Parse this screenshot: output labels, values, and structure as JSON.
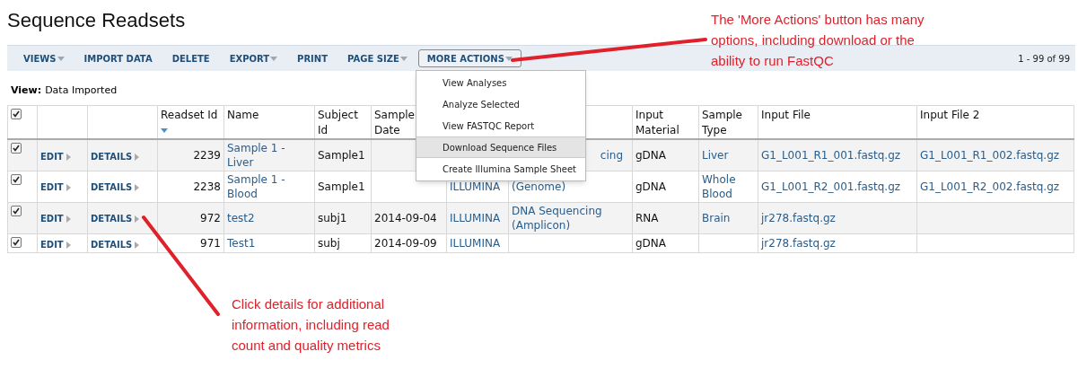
{
  "title": "Sequence Readsets",
  "toolbar": [
    {
      "label": "VIEWS",
      "dropdown": true
    },
    {
      "label": "IMPORT DATA",
      "dropdown": false
    },
    {
      "label": "DELETE",
      "dropdown": false
    },
    {
      "label": "EXPORT",
      "dropdown": true
    },
    {
      "label": "PRINT",
      "dropdown": false
    },
    {
      "label": "PAGE SIZE",
      "dropdown": true
    },
    {
      "label": "MORE ACTIONS",
      "dropdown": true,
      "expanded": true
    }
  ],
  "pagination": "1 - 99 of 99",
  "view": {
    "label": "View:",
    "value": "Data Imported"
  },
  "menu": [
    {
      "label": "View Analyses",
      "selected": false
    },
    {
      "label": "Analyze Selected",
      "selected": false
    },
    {
      "label": "View FASTQC Report",
      "selected": false
    },
    {
      "label": "Download Sequence Files",
      "selected": true
    },
    {
      "label": "Create Illumina Sample Sheet",
      "selected": false
    }
  ],
  "table": {
    "all_checked": true,
    "columns": [
      {
        "label": "Readset Id",
        "sorted": true
      },
      {
        "label": "Name",
        "sorted": false
      },
      {
        "label": "Subject Id",
        "sorted": false
      },
      {
        "label": "Sample Date",
        "sorted": false
      },
      {
        "label": "Input Material",
        "sorted": false
      },
      {
        "label": "Sample Type",
        "sorted": false
      },
      {
        "label": "Input File",
        "sorted": false
      },
      {
        "label": "Input File 2",
        "sorted": false
      }
    ],
    "rows": [
      {
        "checked": true,
        "edit": "EDIT",
        "details": "DETAILS",
        "readset_id": "2239",
        "name": "Sample 1 - Liver",
        "subject_id": "Sample1",
        "sample_date": "",
        "platform": "",
        "application": "cing",
        "input_material": "gDNA",
        "sample_type": "Liver",
        "input_file": "G1_L001_R1_001.fastq.gz",
        "input_file_2": "G1_L001_R1_002.fastq.gz"
      },
      {
        "checked": true,
        "edit": "EDIT",
        "details": "DETAILS",
        "readset_id": "2238",
        "name": "Sample 1 - Blood",
        "subject_id": "Sample1",
        "sample_date": "",
        "platform": "ILLUMINA",
        "application": "(Genome)",
        "input_material": "gDNA",
        "sample_type": "Whole Blood",
        "input_file": "G1_L001_R2_001.fastq.gz",
        "input_file_2": "G1_L001_R2_002.fastq.gz"
      },
      {
        "checked": true,
        "edit": "EDIT",
        "details": "DETAILS",
        "readset_id": "972",
        "name": "test2",
        "subject_id": "subj1",
        "sample_date": "2014-09-04",
        "platform": "ILLUMINA",
        "application": "DNA Sequencing (Amplicon)",
        "input_material": "RNA",
        "sample_type": "Brain",
        "input_file": "jr278.fastq.gz",
        "input_file_2": ""
      },
      {
        "checked": true,
        "edit": "EDIT",
        "details": "DETAILS",
        "readset_id": "971",
        "name": "Test1",
        "subject_id": "subj",
        "sample_date": "2014-09-09",
        "platform": "ILLUMINA",
        "application": "",
        "input_material": "gDNA",
        "sample_type": "",
        "input_file": "jr278.fastq.gz",
        "input_file_2": ""
      }
    ]
  },
  "annotations": [
    {
      "text": "The 'More Actions' button has many options, including download or the ability to run FastQC"
    },
    {
      "text": "Click details for additional information, including read count and quality metrics"
    }
  ]
}
